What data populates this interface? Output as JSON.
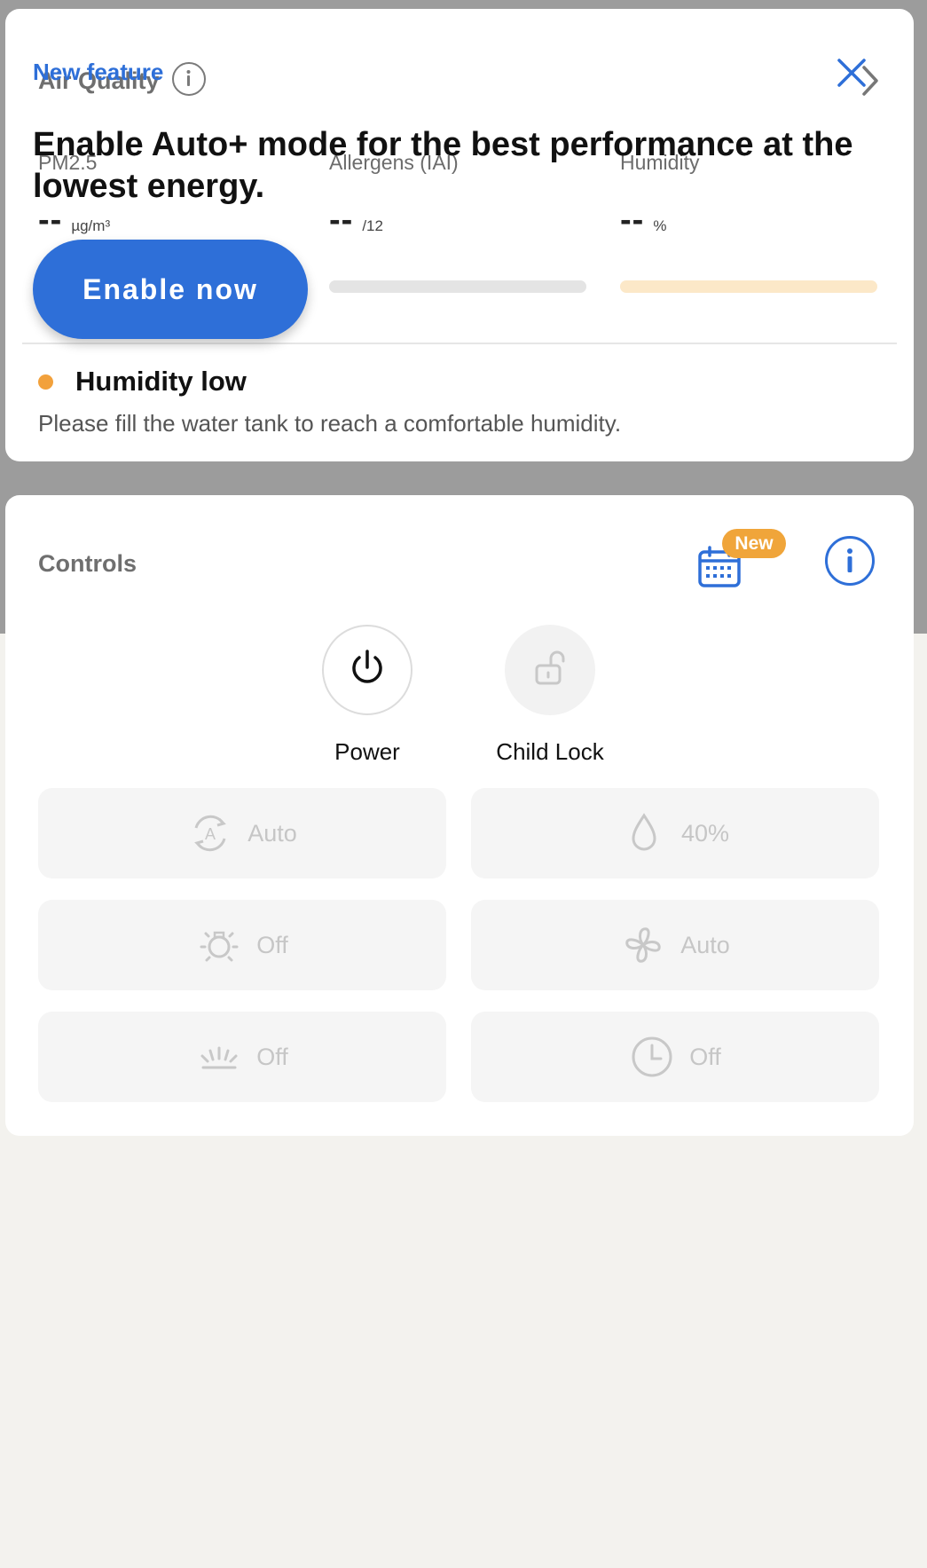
{
  "air_quality": {
    "title": "Air Quality",
    "metrics": [
      {
        "label": "PM2.5",
        "value": "--",
        "unit": "µg/m³",
        "bar_color": "#e4e4e4"
      },
      {
        "label": "Allergens (IAI)",
        "value": "--",
        "unit": "/12",
        "bar_color": "#e4e4e4"
      },
      {
        "label": "Humidity",
        "value": "--",
        "unit": "%",
        "bar_color": "#fce8c8"
      }
    ],
    "alert": {
      "title": "Humidity low",
      "message": "Please fill the water tank to reach a comfortable humidity.",
      "dot_color": "#f2a13c"
    }
  },
  "controls": {
    "title": "Controls",
    "schedule_badge": "New",
    "power_label": "Power",
    "child_lock_label": "Child Lock",
    "tiles": [
      {
        "icon": "auto-mode-icon",
        "label": "Auto"
      },
      {
        "icon": "water-drop-icon",
        "label": "40%"
      },
      {
        "icon": "light-bulb-icon",
        "label": "Off"
      },
      {
        "icon": "fan-icon",
        "label": "Auto"
      },
      {
        "icon": "brightness-icon",
        "label": "Off"
      },
      {
        "icon": "timer-icon",
        "label": "Off"
      }
    ]
  },
  "promo": {
    "eyebrow": "New feature",
    "headline": "Enable Auto+ mode for the best performance at the lowest energy.",
    "button_label": "Enable now"
  },
  "colors": {
    "accent": "#2e6fd8",
    "warning": "#f2a13c",
    "promo_bg": "#e9eff8"
  }
}
